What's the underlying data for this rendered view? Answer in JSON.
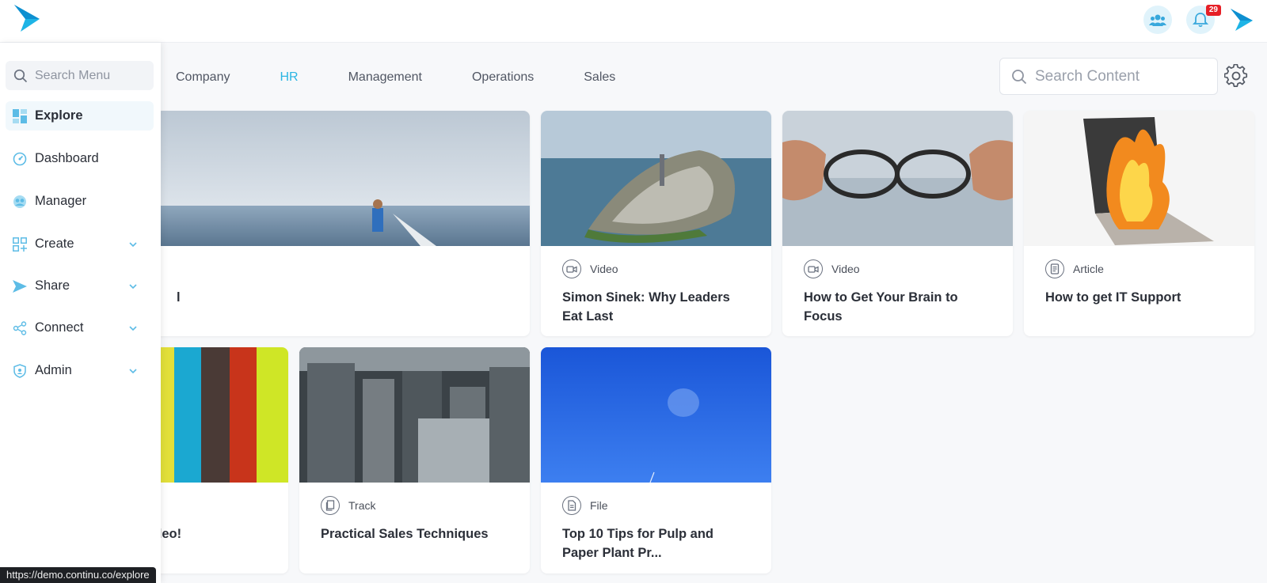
{
  "header": {
    "notification_count": "29",
    "accent_color": "#1eb4e6",
    "icons": [
      "logo-icon",
      "team-icon",
      "bell-icon",
      "brand-icon"
    ]
  },
  "sidebar": {
    "search_placeholder": "Search Menu",
    "items": [
      {
        "label": "Explore",
        "icon": "explore-icon",
        "active": true
      },
      {
        "label": "Dashboard",
        "icon": "dashboard-icon"
      },
      {
        "label": "Manager",
        "icon": "manager-icon"
      },
      {
        "label": "Create",
        "icon": "create-icon",
        "expandable": true
      },
      {
        "label": "Share",
        "icon": "share-icon",
        "expandable": true
      },
      {
        "label": "Connect",
        "icon": "connect-icon",
        "expandable": true
      },
      {
        "label": "Admin",
        "icon": "admin-icon",
        "expandable": true
      }
    ]
  },
  "tabs": [
    {
      "label": "Company"
    },
    {
      "label": "HR",
      "active": true
    },
    {
      "label": "Management"
    },
    {
      "label": "Operations"
    },
    {
      "label": "Sales"
    }
  ],
  "search": {
    "placeholder": "Search Content"
  },
  "cards": [
    {
      "type": "",
      "title": "l"
    },
    {
      "type": "Video",
      "title": "Simon Sinek: Why Leaders Eat Last"
    },
    {
      "type": "Video",
      "title": "How to Get Your Brain to Focus"
    },
    {
      "type": "Article",
      "title": "How to get IT Support"
    },
    {
      "type": "",
      "title": "Video!"
    },
    {
      "type": "Track",
      "title": "Practical Sales Techniques"
    },
    {
      "type": "File",
      "title": "Top 10 Tips for Pulp and Paper Plant Pr..."
    }
  ],
  "status_url": "https://demo.continu.co/explore"
}
